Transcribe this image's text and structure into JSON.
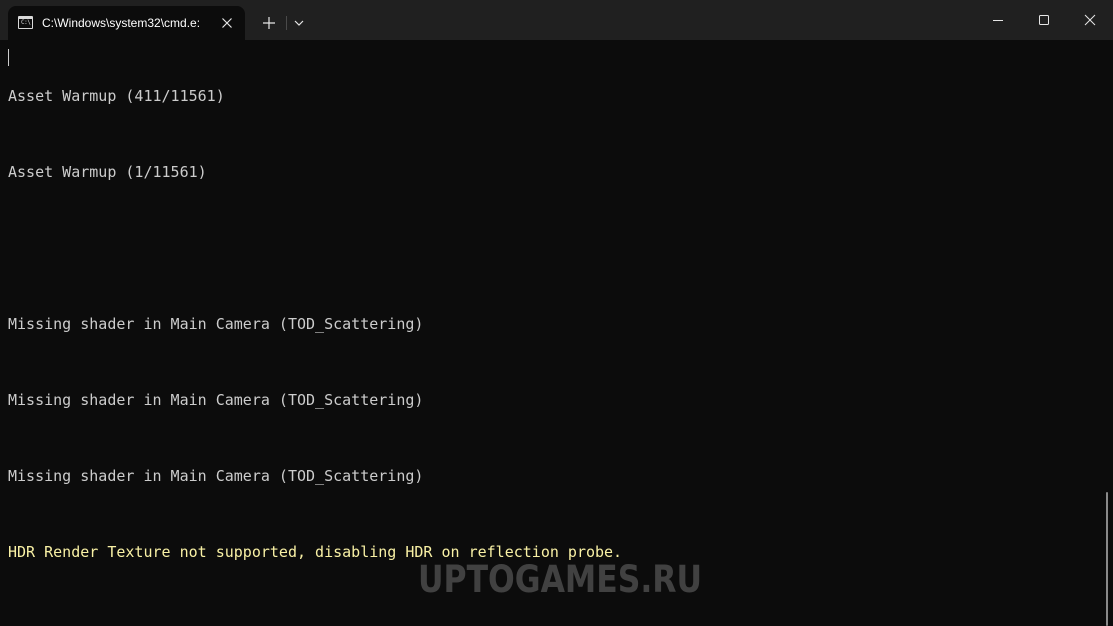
{
  "window": {
    "tab_title": "C:\\Windows\\system32\\cmd.e:",
    "tab_icon_text": "C:\\",
    "icons": {
      "tab_icon": "terminal-icon",
      "tab_close": "close-icon",
      "new_tab": "plus-icon",
      "dropdown": "chevron-down-icon",
      "minimize": "minimize-icon",
      "maximize": "maximize-icon",
      "close": "close-icon"
    }
  },
  "console": {
    "lines": [
      "Asset Warmup (411/11561)",
      "Asset Warmup (1/11561)",
      "Missing shader in Main Camera (TOD_Scattering)",
      "Missing shader in Main Camera (TOD_Scattering)",
      "Missing shader in Main Camera (TOD_Scattering)",
      "HDR Render Texture not supported, disabling HDR on reflection probe."
    ],
    "colors": {
      "default": "#cccccc",
      "warning": "#f9f1a5",
      "background": "#0c0c0c"
    }
  },
  "watermark": "UPTOGAMES.RU"
}
